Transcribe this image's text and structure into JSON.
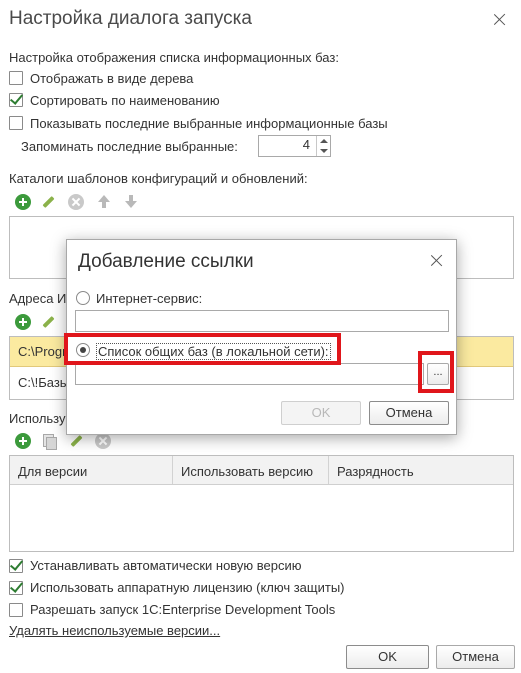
{
  "window": {
    "title": "Настройка диалога запуска"
  },
  "display_section": {
    "heading": "Настройка отображения списка информационных баз:",
    "options": [
      {
        "label": "Отображать в виде дерева",
        "checked": false
      },
      {
        "label": "Сортировать по наименованию",
        "checked": true
      },
      {
        "label": "Показывать последние выбранные информационные базы",
        "checked": false
      }
    ],
    "remember_label": "Запоминать последние выбранные:",
    "remember_value": "4"
  },
  "templates_section": {
    "heading": "Каталоги шаблонов конфигураций и обновлений:"
  },
  "addresses_section": {
    "heading_partial": "Адреса И",
    "rows": [
      "C:\\Progr",
      "C:\\!Базь"
    ]
  },
  "versions_section": {
    "heading_partial": "Использу",
    "columns": [
      "Для версии",
      "Использовать версию",
      "Разрядность"
    ]
  },
  "bottom_options": [
    {
      "label": "Устанавливать автоматически новую версию",
      "checked": true
    },
    {
      "label": "Использовать аппаратную лицензию (ключ защиты)",
      "checked": true
    },
    {
      "label": "Разрешать запуск 1C:Enterprise Development Tools",
      "checked": false
    }
  ],
  "cleanup_link": "Удалять неиспользуемые версии...",
  "buttons": {
    "ok": "OK",
    "cancel": "Отмена"
  },
  "dialog": {
    "title": "Добавление ссылки",
    "internet_service_label": "Интернет-сервис:",
    "internet_service_value": "",
    "shared_list_label": "Список общих баз (в локальной сети):",
    "shared_list_value": "",
    "browse_label": "...",
    "ok": "OK",
    "cancel": "Отмена",
    "selected_option": "shared_list"
  },
  "colors": {
    "selection_row": "#fbeaa0",
    "highlight_box": "#e0161b",
    "check_green": "#2e7d32",
    "add_icon": "#3c9a3c"
  }
}
